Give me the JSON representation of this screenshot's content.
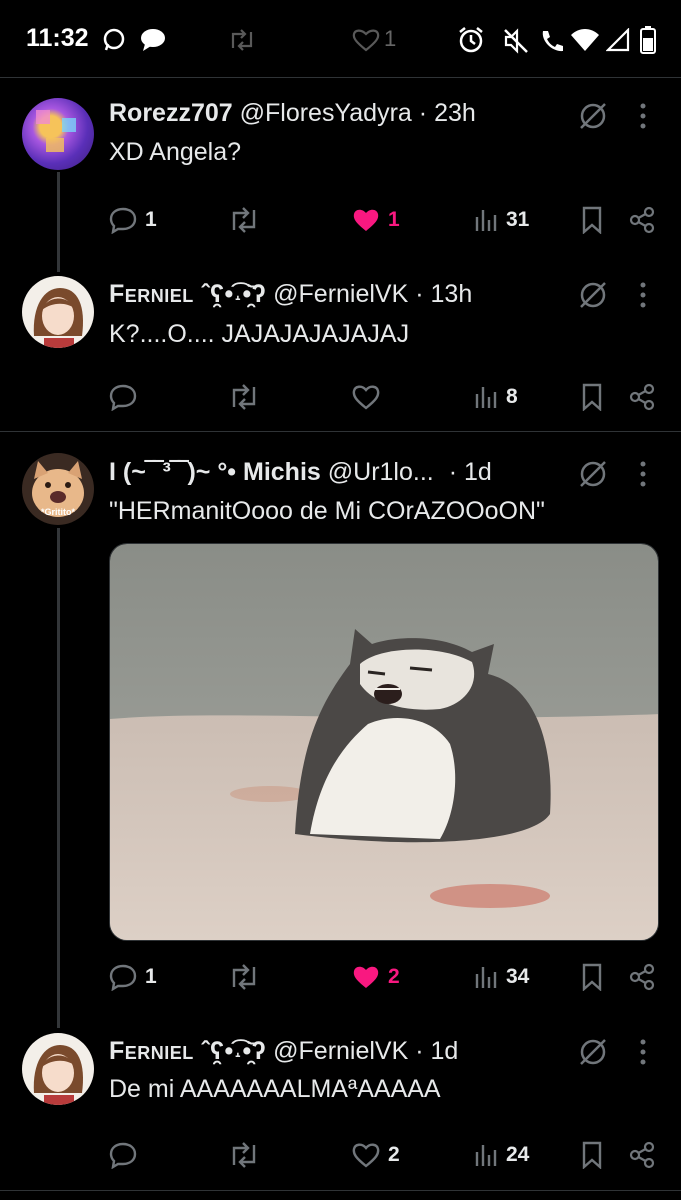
{
  "status_bar": {
    "time": "11:32",
    "likes_preview": "1"
  },
  "tweets": [
    {
      "display_name": "Rorezz707",
      "handle": "@FloresYadyra",
      "separator": "·",
      "age": "23h",
      "text": "XD Angela?",
      "replies": "1",
      "retweets": "",
      "likes": "1",
      "liked": true,
      "views": "31"
    },
    {
      "display_name": "Ferniel ˆʕ̯•͡˔•̯᷅ʔ",
      "handle": "@FernielVK",
      "separator": "·",
      "age": "13h",
      "text": "K?....O....  JAJAJAJAJAJAJ",
      "replies": "",
      "retweets": "",
      "likes": "",
      "liked": false,
      "views": "8"
    },
    {
      "display_name": "I (~‾‾³‾‾)~ °• Michis",
      "handle": "@Ur1lo...",
      "separator": "·",
      "age": "1d",
      "text": "\"HERmanitOooo de Mi COrAZOOoON\"",
      "avatar_caption": "*Gritito*",
      "replies": "1",
      "retweets": "",
      "likes": "2",
      "liked": true,
      "views": "34"
    },
    {
      "display_name": "Ferniel ˆʕ̯•͡˔•̯᷅ʔ",
      "handle": "@FernielVK",
      "separator": "·",
      "age": "1d",
      "text": "De mi AAAAAAALMAªAAAAA",
      "replies": "",
      "retweets": "",
      "likes": "2",
      "liked": false,
      "views": "24"
    }
  ],
  "icons": {
    "reply": "reply-icon",
    "retweet": "retweet-icon",
    "like": "heart-icon",
    "views": "views-icon",
    "bookmark": "bookmark-icon",
    "share": "share-icon",
    "grok": "grok-icon",
    "more": "more-icon"
  },
  "colors": {
    "background": "#000000",
    "text": "#e7e9ea",
    "muted": "#71767b",
    "like": "#f91880",
    "divider": "#2f3336"
  }
}
